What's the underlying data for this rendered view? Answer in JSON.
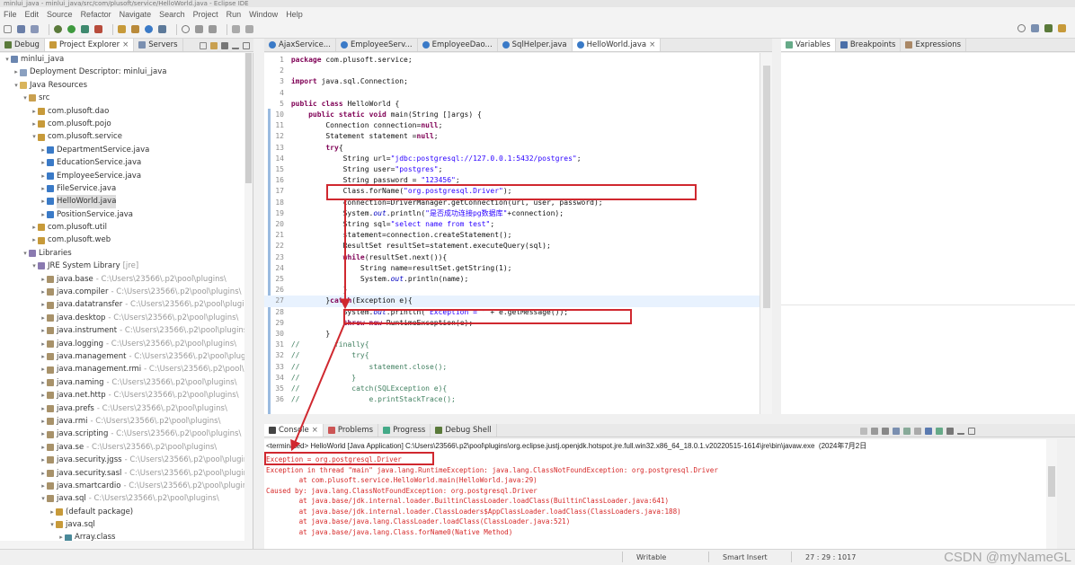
{
  "window": {
    "title": "minlui_java - minlui_java/src/com/plusoft/service/HelloWorld.java - Eclipse IDE"
  },
  "menu": [
    "File",
    "Edit",
    "Source",
    "Refactor",
    "Navigate",
    "Search",
    "Project",
    "Run",
    "Window",
    "Help"
  ],
  "left_tabs": [
    "Debug",
    "Project Explorer",
    "Servers"
  ],
  "editor_tabs": [
    "AjaxService...",
    "EmployeeServ...",
    "EmployeeDao...",
    "SqlHelper.java",
    "HelloWorld.java"
  ],
  "right_tabs": [
    "Variables",
    "Breakpoints",
    "Expressions"
  ],
  "tree": [
    {
      "depth": 0,
      "arrow": "v",
      "label": "minlui_java",
      "icon": "project-icon"
    },
    {
      "depth": 1,
      "arrow": ">",
      "label": "Deployment Descriptor: minlui_java",
      "icon": "descriptor-icon"
    },
    {
      "depth": 1,
      "arrow": "v",
      "label": "Java Resources",
      "icon": "folder-icon"
    },
    {
      "depth": 2,
      "arrow": "v",
      "label": "src",
      "icon": "package-folder-icon"
    },
    {
      "depth": 3,
      "arrow": ">",
      "label": "com.plusoft.dao",
      "icon": "package-icon"
    },
    {
      "depth": 3,
      "arrow": ">",
      "label": "com.plusoft.pojo",
      "icon": "package-icon"
    },
    {
      "depth": 3,
      "arrow": "v",
      "label": "com.plusoft.service",
      "icon": "package-icon"
    },
    {
      "depth": 4,
      "arrow": ">",
      "label": "DepartmentService.java",
      "icon": "java-file-icon"
    },
    {
      "depth": 4,
      "arrow": ">",
      "label": "EducationService.java",
      "icon": "java-file-icon"
    },
    {
      "depth": 4,
      "arrow": ">",
      "label": "EmployeeService.java",
      "icon": "java-file-icon"
    },
    {
      "depth": 4,
      "arrow": ">",
      "label": "FileService.java",
      "icon": "java-file-icon"
    },
    {
      "depth": 4,
      "arrow": ">",
      "label": "HelloWorld.java",
      "icon": "java-file-icon",
      "selected": true
    },
    {
      "depth": 4,
      "arrow": ">",
      "label": "PositionService.java",
      "icon": "java-file-icon"
    },
    {
      "depth": 3,
      "arrow": ">",
      "label": "com.plusoft.util",
      "icon": "package-icon"
    },
    {
      "depth": 3,
      "arrow": ">",
      "label": "com.plusoft.web",
      "icon": "package-icon"
    },
    {
      "depth": 2,
      "arrow": "v",
      "label": "Libraries",
      "icon": "library-icon"
    },
    {
      "depth": 3,
      "arrow": "v",
      "label": "JRE System Library",
      "sub": "[jre]",
      "icon": "library-icon"
    },
    {
      "depth": 4,
      "arrow": ">",
      "label": "java.base",
      "sub": "- C:\\Users\\23566\\.p2\\pool\\plugins\\",
      "icon": "jar-icon"
    },
    {
      "depth": 4,
      "arrow": ">",
      "label": "java.compiler",
      "sub": "- C:\\Users\\23566\\.p2\\pool\\plugins\\",
      "icon": "jar-icon"
    },
    {
      "depth": 4,
      "arrow": ">",
      "label": "java.datatransfer",
      "sub": "- C:\\Users\\23566\\.p2\\pool\\plugins\\",
      "icon": "jar-icon"
    },
    {
      "depth": 4,
      "arrow": ">",
      "label": "java.desktop",
      "sub": "- C:\\Users\\23566\\.p2\\pool\\plugins\\",
      "icon": "jar-icon"
    },
    {
      "depth": 4,
      "arrow": ">",
      "label": "java.instrument",
      "sub": "- C:\\Users\\23566\\.p2\\pool\\plugins\\",
      "icon": "jar-icon"
    },
    {
      "depth": 4,
      "arrow": ">",
      "label": "java.logging",
      "sub": "- C:\\Users\\23566\\.p2\\pool\\plugins\\",
      "icon": "jar-icon"
    },
    {
      "depth": 4,
      "arrow": ">",
      "label": "java.management",
      "sub": "- C:\\Users\\23566\\.p2\\pool\\plugins\\",
      "icon": "jar-icon"
    },
    {
      "depth": 4,
      "arrow": ">",
      "label": "java.management.rmi",
      "sub": "- C:\\Users\\23566\\.p2\\pool\\plugins\\",
      "icon": "jar-icon"
    },
    {
      "depth": 4,
      "arrow": ">",
      "label": "java.naming",
      "sub": "- C:\\Users\\23566\\.p2\\pool\\plugins\\",
      "icon": "jar-icon"
    },
    {
      "depth": 4,
      "arrow": ">",
      "label": "java.net.http",
      "sub": "- C:\\Users\\23566\\.p2\\pool\\plugins\\",
      "icon": "jar-icon"
    },
    {
      "depth": 4,
      "arrow": ">",
      "label": "java.prefs",
      "sub": "- C:\\Users\\23566\\.p2\\pool\\plugins\\",
      "icon": "jar-icon"
    },
    {
      "depth": 4,
      "arrow": ">",
      "label": "java.rmi",
      "sub": "- C:\\Users\\23566\\.p2\\pool\\plugins\\",
      "icon": "jar-icon"
    },
    {
      "depth": 4,
      "arrow": ">",
      "label": "java.scripting",
      "sub": "- C:\\Users\\23566\\.p2\\pool\\plugins\\",
      "icon": "jar-icon"
    },
    {
      "depth": 4,
      "arrow": ">",
      "label": "java.se",
      "sub": "- C:\\Users\\23566\\.p2\\pool\\plugins\\",
      "icon": "jar-icon"
    },
    {
      "depth": 4,
      "arrow": ">",
      "label": "java.security.jgss",
      "sub": "- C:\\Users\\23566\\.p2\\pool\\plugins\\",
      "icon": "jar-icon"
    },
    {
      "depth": 4,
      "arrow": ">",
      "label": "java.security.sasl",
      "sub": "- C:\\Users\\23566\\.p2\\pool\\plugins\\",
      "icon": "jar-icon"
    },
    {
      "depth": 4,
      "arrow": ">",
      "label": "java.smartcardio",
      "sub": "- C:\\Users\\23566\\.p2\\pool\\plugins\\",
      "icon": "jar-icon"
    },
    {
      "depth": 4,
      "arrow": "v",
      "label": "java.sql",
      "sub": "- C:\\Users\\23566\\.p2\\pool\\plugins\\",
      "icon": "jar-icon"
    },
    {
      "depth": 5,
      "arrow": ">",
      "label": "(default package)",
      "icon": "package-icon"
    },
    {
      "depth": 5,
      "arrow": "v",
      "label": "java.sql",
      "icon": "package-icon"
    },
    {
      "depth": 6,
      "arrow": ">",
      "label": "Array.class",
      "icon": "class-file-icon"
    }
  ],
  "code": [
    {
      "n": "1",
      "text": "package com.plusoft.service;"
    },
    {
      "n": "2",
      "text": ""
    },
    {
      "n": "3",
      "text": "import java.sql.Connection;"
    },
    {
      "n": "4",
      "text": ""
    },
    {
      "n": "5",
      "text": "public class HelloWorld {"
    },
    {
      "n": "10",
      "text": "    public static void main(String []args) {"
    },
    {
      "n": "11",
      "text": "        Connection connection=null;"
    },
    {
      "n": "12",
      "text": "        Statement statement =null;"
    },
    {
      "n": "13",
      "text": "        try{"
    },
    {
      "n": "14",
      "text": "            String url=\"jdbc:postgresql://127.0.0.1:5432/postgres\";"
    },
    {
      "n": "15",
      "text": "            String user=\"postgres\";"
    },
    {
      "n": "16",
      "text": "            String password = \"123456\";"
    },
    {
      "n": "17",
      "text": "            Class.forName(\"org.postgresql.Driver\");"
    },
    {
      "n": "18",
      "text": "            connection=DriverManager.getConnection(url, user, password);"
    },
    {
      "n": "19",
      "text": "            System.out.println(\"是否成功连接pg数据库\"+connection);"
    },
    {
      "n": "20",
      "text": "            String sql=\"select name from test\";"
    },
    {
      "n": "21",
      "text": "            statement=connection.createStatement();"
    },
    {
      "n": "22",
      "text": "            ResultSet resultSet=statement.executeQuery(sql);"
    },
    {
      "n": "23",
      "text": "            while(resultSet.next()){"
    },
    {
      "n": "24",
      "text": "                String name=resultSet.getString(1);"
    },
    {
      "n": "25",
      "text": "                System.out.println(name);"
    },
    {
      "n": "26",
      "text": "            }"
    },
    {
      "n": "27",
      "text": "        }catch(Exception e){"
    },
    {
      "n": "28",
      "text": "            System.out.println(\"Exception = \" + e.getMessage());"
    },
    {
      "n": "29",
      "text": "            throw new RuntimeException(e);"
    },
    {
      "n": "30",
      "text": "        }"
    },
    {
      "n": "31",
      "text": "//        finally{"
    },
    {
      "n": "32",
      "text": "//            try{"
    },
    {
      "n": "33",
      "text": "//                statement.close();"
    },
    {
      "n": "34",
      "text": "//            }"
    },
    {
      "n": "35",
      "text": "//            catch(SQLException e){"
    },
    {
      "n": "36",
      "text": "//                e.printStackTrace();"
    }
  ],
  "console_tabs": [
    "Console",
    "Problems",
    "Progress",
    "Debug Shell"
  ],
  "console": {
    "header": "<terminated> HelloWorld [Java Application] C:\\Users\\23566\\.p2\\pool\\plugins\\org.eclipse.justj.openjdk.hotspot.jre.full.win32.x86_64_18.0.1.v20220515-1614\\jre\\bin\\javaw.exe  (2024年7月2日",
    "lines": [
      {
        "cls": "red",
        "text": "Exception = org.postgresql.Driver"
      },
      {
        "cls": "red",
        "text": "Exception in thread \"main\" java.lang.RuntimeException: java.lang.ClassNotFoundException: org.postgresql.Driver"
      },
      {
        "cls": "red",
        "text": "        at com.plusoft.service.HelloWorld.main(HelloWorld.java:29)"
      },
      {
        "cls": "red",
        "text": "Caused by: java.lang.ClassNotFoundException: org.postgresql.Driver"
      },
      {
        "cls": "red",
        "text": "        at java.base/jdk.internal.loader.BuiltinClassLoader.loadClass(BuiltinClassLoader.java:641)"
      },
      {
        "cls": "red",
        "text": "        at java.base/jdk.internal.loader.ClassLoaders$AppClassLoader.loadClass(ClassLoaders.java:188)"
      },
      {
        "cls": "red",
        "text": "        at java.base/java.lang.ClassLoader.loadClass(ClassLoader.java:521)"
      },
      {
        "cls": "red",
        "text": "        at java.base/java.lang.Class.forName0(Native Method)"
      }
    ]
  },
  "status": {
    "writable": "Writable",
    "insert": "Smart Insert",
    "position": "27 : 29 : 1017"
  },
  "watermark": "CSDN @myNameGL"
}
